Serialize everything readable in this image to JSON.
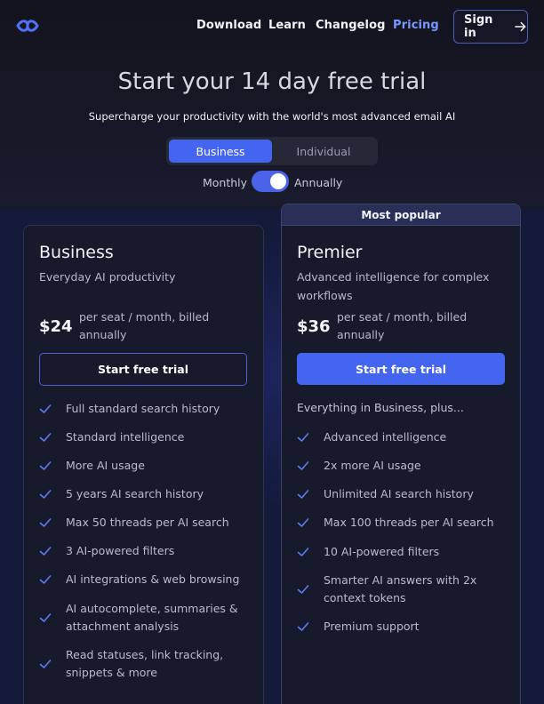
{
  "nav": {
    "links": [
      "Download",
      "Learn",
      "Changelog",
      "Pricing"
    ],
    "active": "Pricing",
    "signin_label": "Sign in"
  },
  "hero": {
    "title": "Start your 14 day free trial",
    "subtitle": "Supercharge your productivity with the world's most advanced email AI"
  },
  "audience_tabs": [
    "Business",
    "Individual"
  ],
  "audience_selected": "Business",
  "billing": {
    "monthly_label": "Monthly",
    "annually_label": "Annually",
    "annually_selected": true
  },
  "plans": [
    {
      "name": "Business",
      "description": "Everyday AI productivity",
      "price": "$24",
      "price_note": "per seat / month, billed annually",
      "cta": "Start free trial",
      "features": [
        "Full standard search history",
        "Standard intelligence",
        "More AI usage",
        "5 years AI search history",
        "Max 50 threads per AI search",
        "3 AI-powered filters",
        "AI integrations & web browsing",
        "AI autocomplete, summaries & attachment analysis",
        "Read statuses, link tracking, snippets & more"
      ]
    },
    {
      "badge": "Most popular",
      "name": "Premier",
      "description": "Advanced intelligence for complex workflows",
      "price": "$36",
      "price_note": "per seat / month, billed annually",
      "cta": "Start free trial",
      "intro": "Everything in Business, plus...",
      "features": [
        "Advanced intelligence",
        "2x more AI usage",
        "Unlimited AI search history",
        "Max 100 threads per AI search",
        "10 AI-powered filters",
        "Smarter AI answers with 2x context tokens",
        "Premium support"
      ]
    }
  ],
  "colors": {
    "accent": "#4465f0",
    "nav_active": "#7b97ff",
    "background": "#121320",
    "card": "#171a2b",
    "check": "#5b7cf5"
  },
  "icons": {
    "logo": "brand-logo-icon",
    "signin_arrow": "arrow-right-icon",
    "feature_check": "check-icon"
  }
}
